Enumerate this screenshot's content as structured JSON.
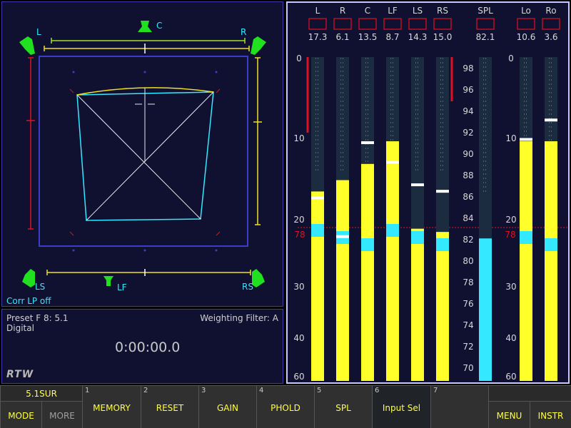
{
  "surround": {
    "speakers": {
      "L": "L",
      "C": "C",
      "R": "R",
      "LS": "LS",
      "LF": "LF",
      "RS": "RS"
    },
    "status": "Corr LP off"
  },
  "info": {
    "preset": "Preset F 8: 5.1",
    "weighting": "Weighting Filter: A",
    "input": "Digital",
    "timer": "0:00:00.0",
    "logo": "RTW"
  },
  "meters": {
    "left_scale": [
      "0",
      "10",
      "20",
      "30",
      "40",
      "60"
    ],
    "right_scale": [
      "0",
      "10",
      "20",
      "30",
      "40",
      "60"
    ],
    "spl_scale": [
      "98",
      "96",
      "94",
      "92",
      "90",
      "88",
      "86",
      "84",
      "82",
      "80",
      "78",
      "76",
      "74",
      "72",
      "70"
    ],
    "ref_label": "78",
    "channels": [
      {
        "name": "L",
        "value": "17.3",
        "level": 0.585,
        "peak": 0.57
      },
      {
        "name": "R",
        "value": "6.1",
        "level": 0.62,
        "peak": 0.45
      },
      {
        "name": "C",
        "value": "13.5",
        "level": 0.67,
        "peak": 0.74
      },
      {
        "name": "LF",
        "value": "8.7",
        "level": 0.74,
        "peak": 0.68
      },
      {
        "name": "LS",
        "value": "14.3",
        "level": 0.47,
        "peak": 0.61
      },
      {
        "name": "RS",
        "value": "15.0",
        "level": 0.46,
        "peak": 0.59
      }
    ],
    "spl": {
      "name": "SPL",
      "value": "82.1",
      "level": 0.44
    },
    "downmix": [
      {
        "name": "Lo",
        "value": "10.6",
        "level": 0.74,
        "peak": 0.75
      },
      {
        "name": "Ro",
        "value": "3.6",
        "level": 0.74,
        "peak": 0.81
      }
    ]
  },
  "softkeys": {
    "top_label": "5.1SUR",
    "mode": "MODE",
    "more": "MORE",
    "keys": [
      {
        "num": "1",
        "label": "MEMORY"
      },
      {
        "num": "2",
        "label": "RESET"
      },
      {
        "num": "3",
        "label": "GAIN"
      },
      {
        "num": "4",
        "label": "PHOLD"
      },
      {
        "num": "5",
        "label": "SPL"
      },
      {
        "num": "6",
        "label": "Input Sel"
      },
      {
        "num": "7",
        "label": ""
      }
    ],
    "menu": "MENU",
    "instr": "INSTR"
  },
  "colors": {
    "bar": "#ffff2a",
    "bar_cyan": "#33e8ff",
    "bg": "#101030",
    "red": "#e01020"
  }
}
